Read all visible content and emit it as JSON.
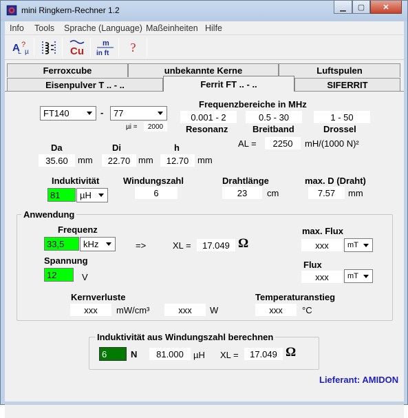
{
  "window": {
    "title": "mini Ringkern-Rechner 1.2"
  },
  "menu": [
    "Info",
    "Tools",
    "Sprache (Language)",
    "Maßeinheiten",
    "Hilfe"
  ],
  "toolbar": {
    "unit_m": "m",
    "unit_inft": "in ft",
    "cu": "Cu",
    "help": "?"
  },
  "tabs_row1": [
    "Ferroxcube",
    "unbekannte Kerne",
    "Luftspulen"
  ],
  "tabs_row2": [
    "Eisenpulver T .. - ..",
    "Ferrit FT .. - ..",
    "SIFERRIT"
  ],
  "core": {
    "type": "FT140",
    "dash": "-",
    "material": "77",
    "mu_label": "µi =",
    "mu_value": "2000"
  },
  "freq": {
    "title": "Frequenzbereiche in MHz",
    "ranges": [
      "0.001 - 2",
      "0.5 - 30",
      "1 - 50"
    ],
    "labels": [
      "Resonanz",
      "Breitband",
      "Drossel"
    ]
  },
  "al": {
    "label": "AL =",
    "value": "2250",
    "unit": "mH/(1000 N)²"
  },
  "dims": {
    "da_label": "Da",
    "da_value": "35.60",
    "da_unit": "mm",
    "di_label": "Di",
    "di_value": "22.70",
    "di_unit": "mm",
    "h_label": "h",
    "h_value": "12.70",
    "h_unit": "mm"
  },
  "ind": {
    "label": "Induktivität",
    "value": "81",
    "unit": "µH"
  },
  "windings": {
    "label": "Windungszahl",
    "value": "6"
  },
  "wire": {
    "label": "Drahtlänge",
    "value": "23",
    "unit": "cm"
  },
  "maxd": {
    "label": "max. D (Draht)",
    "value": "7.57",
    "unit": "mm"
  },
  "app": {
    "group_title": "Anwendung",
    "freq_label": "Frequenz",
    "freq_value": "33,5",
    "freq_unit": "kHz",
    "arrow": "=>",
    "xl_label": "XL =",
    "xl_value": "17.049",
    "omega": "Ω",
    "maxflux_label": "max. Flux",
    "maxflux_value": "xxx",
    "maxflux_unit": "mT",
    "volt_label": "Spannung",
    "volt_value": "12",
    "volt_unit": "V",
    "flux_label": "Flux",
    "flux_value": "xxx",
    "flux_unit": "mT",
    "loss_label": "Kernverluste",
    "loss1_value": "xxx",
    "loss1_unit": "mW/cm³",
    "loss2_value": "xxx",
    "loss2_unit": "W",
    "temp_label": "Temperaturanstieg",
    "temp_value": "xxx",
    "temp_unit": "°C"
  },
  "calc": {
    "title": "Induktivität aus Windungszahl berechnen",
    "n_value": "6",
    "n_label": "N",
    "ind_value": "81.000",
    "ind_unit": "µH",
    "xl_label": "XL =",
    "xl_value": "17.049",
    "omega": "Ω"
  },
  "supplier": "Lieferant: AMIDON",
  "colors": {
    "green": "#00ff00",
    "dark_green": "#007a00",
    "supplier_blue": "#1f1fbf",
    "title_bg": "#bfd2e8"
  }
}
